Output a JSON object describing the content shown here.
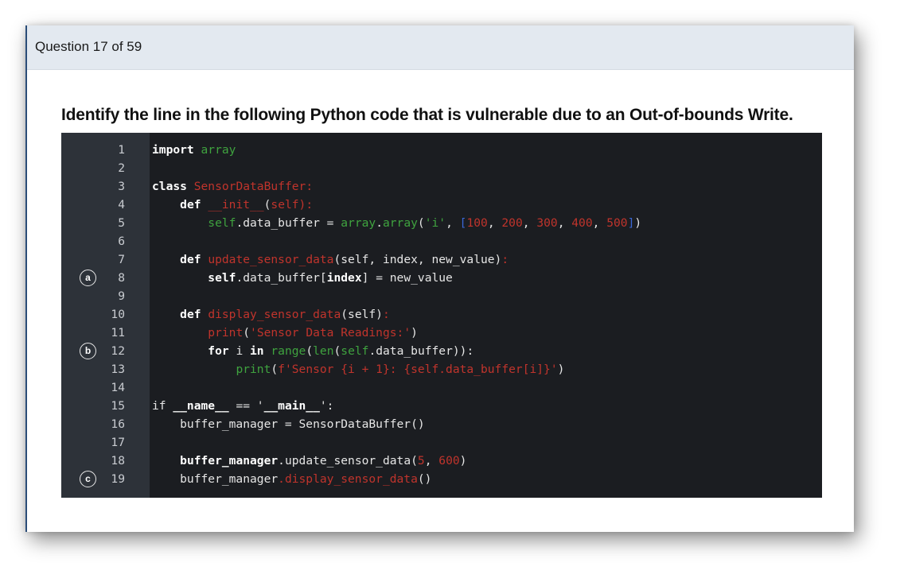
{
  "header": {
    "question_counter": "Question 17 of 59"
  },
  "question": {
    "text": "Identify the line in the following Python code that is vulnerable due to an Out-of-bounds Write."
  },
  "colors": {
    "header_background": "#e3e9f0",
    "code_background": "#1b1d21",
    "gutter_background": "#2d3239",
    "token_green": "#3fa33f",
    "token_red": "#c0342c",
    "token_blue": "#3a67d6"
  },
  "code": {
    "lines": [
      {
        "n": "1",
        "marker": "",
        "tokens": [
          [
            "kw",
            "import"
          ],
          [
            "tx",
            " "
          ],
          [
            "gr",
            "array"
          ]
        ]
      },
      {
        "n": "2",
        "marker": "",
        "tokens": []
      },
      {
        "n": "3",
        "marker": "",
        "tokens": [
          [
            "kw",
            "class"
          ],
          [
            "tx",
            " "
          ],
          [
            "rd",
            "SensorDataBuffer:"
          ]
        ]
      },
      {
        "n": "4",
        "marker": "",
        "tokens": [
          [
            "tx",
            "    "
          ],
          [
            "kw",
            "def"
          ],
          [
            "tx",
            " "
          ],
          [
            "rd",
            "__init__"
          ],
          [
            "tx",
            "("
          ],
          [
            "rd",
            "self):"
          ]
        ]
      },
      {
        "n": "5",
        "marker": "",
        "tokens": [
          [
            "tx",
            "        "
          ],
          [
            "gr",
            "self"
          ],
          [
            "tx",
            ".data_buffer = "
          ],
          [
            "gr",
            "array"
          ],
          [
            "tx",
            "."
          ],
          [
            "gr",
            "array"
          ],
          [
            "tx",
            "("
          ],
          [
            "gr",
            "'i'"
          ],
          [
            "tx",
            ", "
          ],
          [
            "bl",
            "["
          ],
          [
            "rd",
            "100"
          ],
          [
            "tx",
            ", "
          ],
          [
            "rd",
            "200"
          ],
          [
            "tx",
            ", "
          ],
          [
            "rd",
            "300"
          ],
          [
            "tx",
            ", "
          ],
          [
            "rd",
            "400"
          ],
          [
            "tx",
            ", "
          ],
          [
            "rd",
            "500"
          ],
          [
            "bl",
            "]"
          ],
          [
            "tx",
            ")"
          ]
        ]
      },
      {
        "n": "6",
        "marker": "",
        "tokens": []
      },
      {
        "n": "7",
        "marker": "",
        "tokens": [
          [
            "tx",
            "    "
          ],
          [
            "kw",
            "def"
          ],
          [
            "tx",
            " "
          ],
          [
            "rd",
            "update_sensor_data"
          ],
          [
            "tx",
            "(self, index, new_value)"
          ],
          [
            "rd",
            ":"
          ]
        ]
      },
      {
        "n": "8",
        "marker": "a",
        "tokens": [
          [
            "tx",
            "        "
          ],
          [
            "kw",
            "self"
          ],
          [
            "tx",
            ".data_buffer["
          ],
          [
            "kw",
            "index"
          ],
          [
            "tx",
            "] = new_value"
          ]
        ]
      },
      {
        "n": "9",
        "marker": "",
        "tokens": []
      },
      {
        "n": "10",
        "marker": "",
        "tokens": [
          [
            "tx",
            "    "
          ],
          [
            "kw",
            "def"
          ],
          [
            "tx",
            " "
          ],
          [
            "rd",
            "display_sensor_data"
          ],
          [
            "tx",
            "(self)"
          ],
          [
            "rd",
            ":"
          ]
        ]
      },
      {
        "n": "11",
        "marker": "",
        "tokens": [
          [
            "tx",
            "        "
          ],
          [
            "rd",
            "print"
          ],
          [
            "tx",
            "("
          ],
          [
            "rd",
            "'Sensor Data Readings:'"
          ],
          [
            "tx",
            ")"
          ]
        ]
      },
      {
        "n": "12",
        "marker": "b",
        "tokens": [
          [
            "tx",
            "        "
          ],
          [
            "kw",
            "for"
          ],
          [
            "tx",
            " i "
          ],
          [
            "kw",
            "in"
          ],
          [
            "tx",
            " "
          ],
          [
            "gr",
            "range"
          ],
          [
            "tx",
            "("
          ],
          [
            "gr",
            "len"
          ],
          [
            "tx",
            "("
          ],
          [
            "gr",
            "self"
          ],
          [
            "tx",
            ".data_buffer))"
          ],
          [
            "tx",
            ":"
          ]
        ]
      },
      {
        "n": "13",
        "marker": "",
        "tokens": [
          [
            "tx",
            "            "
          ],
          [
            "gr",
            "print"
          ],
          [
            "tx",
            "("
          ],
          [
            "rd",
            "f'Sensor {i + 1}: {self.data_buffer[i]}'"
          ],
          [
            "tx",
            ")"
          ]
        ]
      },
      {
        "n": "14",
        "marker": "",
        "tokens": []
      },
      {
        "n": "15",
        "marker": "",
        "tokens": [
          [
            "tx",
            "if "
          ],
          [
            "kw",
            "__name__"
          ],
          [
            "tx",
            " == '"
          ],
          [
            "kw",
            "__main__"
          ],
          [
            "tx",
            "':"
          ]
        ]
      },
      {
        "n": "16",
        "marker": "",
        "tokens": [
          [
            "tx",
            "    buffer_manager = SensorDataBuffer()"
          ]
        ]
      },
      {
        "n": "17",
        "marker": "",
        "tokens": []
      },
      {
        "n": "18",
        "marker": "",
        "tokens": [
          [
            "tx",
            "    "
          ],
          [
            "kw",
            "buffer_manager"
          ],
          [
            "tx",
            ".update_sensor_data("
          ],
          [
            "rd",
            "5"
          ],
          [
            "tx",
            ", "
          ],
          [
            "rd",
            "600"
          ],
          [
            "tx",
            ")"
          ]
        ]
      },
      {
        "n": "19",
        "marker": "c",
        "tokens": [
          [
            "tx",
            "    buffer_manager"
          ],
          [
            "rd",
            ".display_sensor_data"
          ],
          [
            "tx",
            "()"
          ]
        ]
      }
    ]
  }
}
